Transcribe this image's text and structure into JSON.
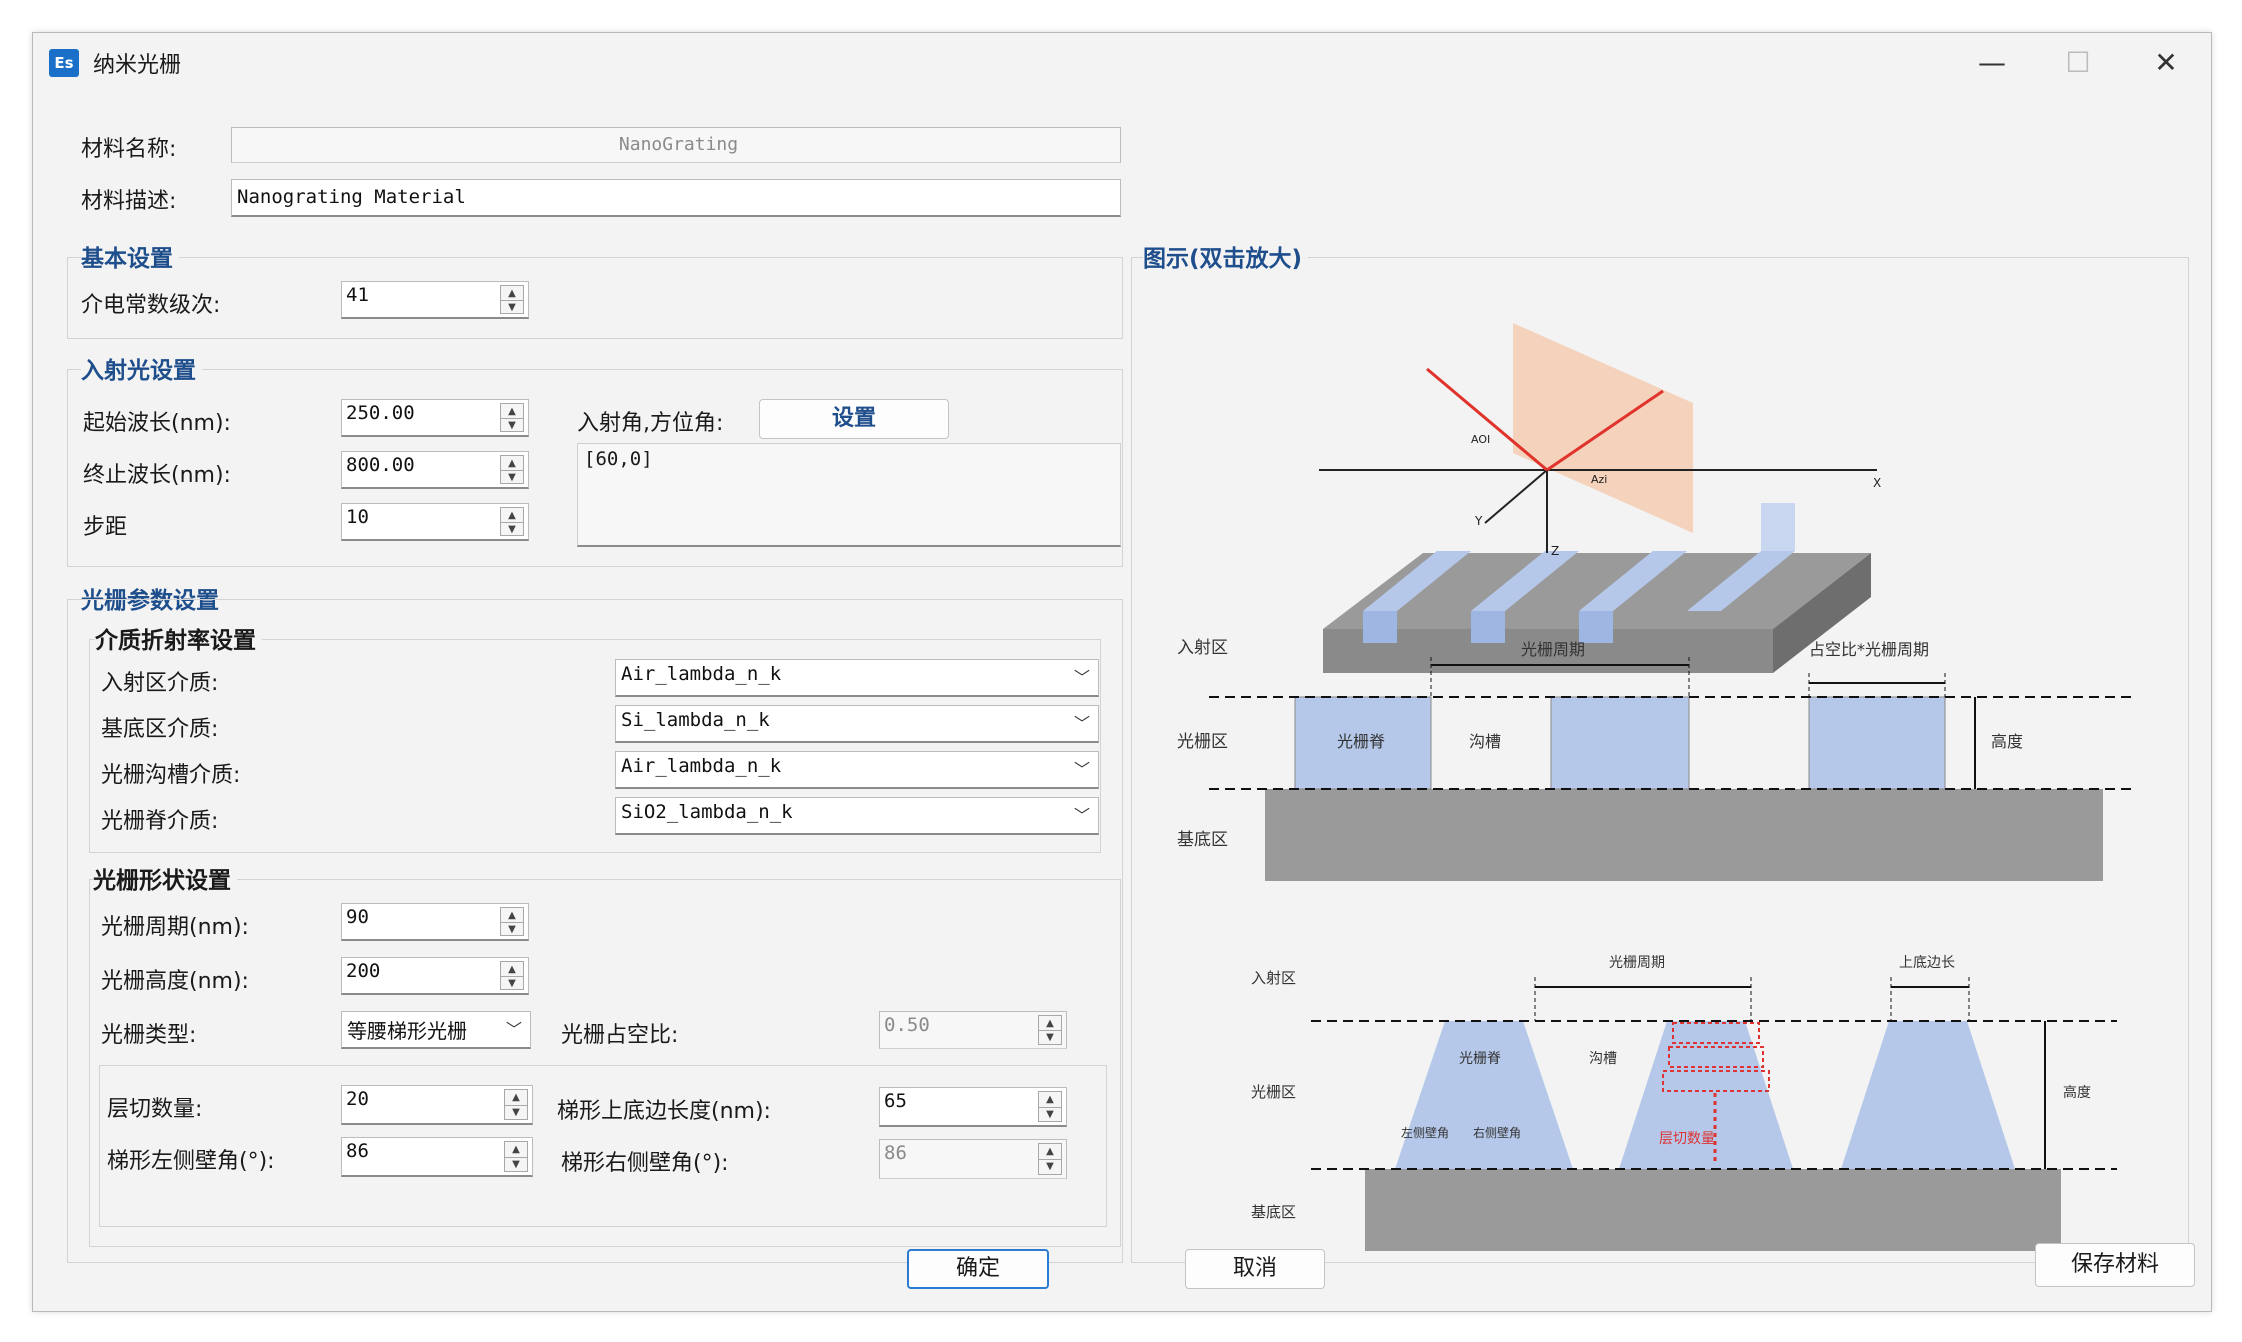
{
  "window": {
    "title": "纳米光栅",
    "app_icon_text": "Es"
  },
  "material": {
    "name_label": "材料名称:",
    "name_value": "NanoGrating",
    "desc_label": "材料描述:",
    "desc_value": "Nanograting Material"
  },
  "basic": {
    "title": "基本设置",
    "dielectric_label": "介电常数级次:",
    "dielectric_value": "41"
  },
  "incident": {
    "title": "入射光设置",
    "start_label": "起始波长(nm):",
    "start_value": "250.00",
    "end_label": "终止波长(nm):",
    "end_value": "800.00",
    "step_label": "步距",
    "step_value": "10",
    "angle_label": "入射角,方位角:",
    "set_button": "设置",
    "angle_value": "[60,0]"
  },
  "grating": {
    "title": "光栅参数设置",
    "medium": {
      "title": "介质折射率设置",
      "incident_label": "入射区介质:",
      "incident_value": "Air_lambda_n_k",
      "substrate_label": "基底区介质:",
      "substrate_value": "Si_lambda_n_k",
      "groove_label": "光栅沟槽介质:",
      "groove_value": "Air_lambda_n_k",
      "ridge_label": "光栅脊介质:",
      "ridge_value": "SiO2_lambda_n_k"
    },
    "shape": {
      "title": "光栅形状设置",
      "period_label": "光栅周期(nm):",
      "period_value": "90",
      "height_label": "光栅高度(nm):",
      "height_value": "200",
      "type_label": "光栅类型:",
      "type_value": "等腰梯形光栅",
      "duty_label": "光栅占空比:",
      "duty_value": "0.50",
      "slices_label": "层切数量:",
      "slices_value": "20",
      "top_len_label": "梯形上底边长度(nm):",
      "top_len_value": "65",
      "left_angle_label": "梯形左侧壁角(°):",
      "left_angle_value": "86",
      "right_angle_label": "梯形右侧壁角(°):",
      "right_angle_value": "86"
    }
  },
  "diagram": {
    "title": "图示(双击放大)",
    "aoi": "AOI",
    "azi": "Azi",
    "axis_x": "X",
    "axis_y": "Y",
    "axis_z": "Z",
    "rect": {
      "incident_zone": "入射区",
      "grating_zone": "光栅区",
      "substrate_zone": "基底区",
      "period": "光栅周期",
      "duty_period": "占空比*光栅周期",
      "ridge": "光栅脊",
      "groove": "沟槽",
      "height": "高度"
    },
    "trap": {
      "incident_zone": "入射区",
      "grating_zone": "光栅区",
      "substrate_zone": "基底区",
      "period": "光栅周期",
      "top_len": "上底边长",
      "ridge": "光栅脊",
      "groove": "沟槽",
      "height": "高度",
      "left_wall": "左侧壁角",
      "right_wall": "右侧壁角",
      "slices": "层切数量"
    }
  },
  "buttons": {
    "ok": "确定",
    "cancel": "取消",
    "save": "保存材料"
  }
}
